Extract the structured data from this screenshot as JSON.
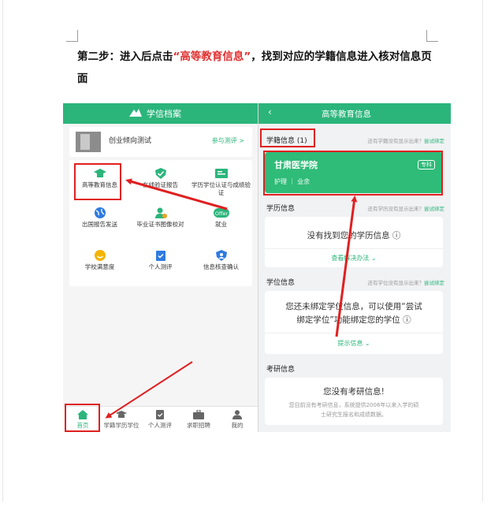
{
  "doc": {
    "intro": "第二步：进入后点击",
    "quoted": "“高等教育信息”",
    "rest": "，找到对应的学籍信息进入核对信息页面"
  },
  "left_app": {
    "title": "学信档案",
    "test_card": {
      "name": "创业倾向测试",
      "action": "参与测评 >"
    },
    "grid": [
      {
        "label": "高等教育信息",
        "icon": "graduation-cap-icon"
      },
      {
        "label": "在线验证报告",
        "icon": "shield-check-icon"
      },
      {
        "label": "学历学位认证与成绩验证",
        "icon": "certificate-icon"
      },
      {
        "label": "出国报告发送",
        "icon": "globe-icon"
      },
      {
        "label": "毕业证书图像校对",
        "icon": "person-check-icon"
      },
      {
        "label": "就业",
        "icon": "offer-icon",
        "icon_text": "Offer"
      },
      {
        "label": "学校满意度",
        "icon": "smile-icon"
      },
      {
        "label": "个人测评",
        "icon": "clipboard-check-icon"
      },
      {
        "label": "信息核查确认",
        "icon": "user-shield-icon"
      }
    ],
    "tabs": [
      {
        "label": "首页",
        "icon": "home-icon",
        "active": true
      },
      {
        "label": "学籍学历学位",
        "icon": "cap-icon",
        "active": false
      },
      {
        "label": "个人测评",
        "icon": "clipboard-icon",
        "active": false
      },
      {
        "label": "求职招聘",
        "icon": "briefcase-icon",
        "active": false
      },
      {
        "label": "我的",
        "icon": "user-icon",
        "active": false
      }
    ]
  },
  "right_app": {
    "back": "‹",
    "title": "高等教育信息",
    "xueji": {
      "title": "学籍信息 (1)",
      "hint": "还有学籍没有显示出来？",
      "hint_link": "尝试绑定",
      "school": "甘肃医学院",
      "major": "护理 ｜ 业余",
      "badge": "专科"
    },
    "xueli": {
      "title": "学历信息",
      "hint": "还有学历没有显示出来？",
      "hint_link": "尝试绑定",
      "main": "没有找到您的学历信息 ⓘ",
      "link": "查看解决办法 ⌄"
    },
    "xuewei": {
      "title": "学位信息",
      "hint": "还有学位没有显示出来？",
      "hint_link": "尝试绑定",
      "main_line1": "您还未绑定学位信息，可以使用“尝试",
      "main_line2": "绑定学位”功能绑定您的学位 ⓘ",
      "link": "提示信息 ⌄"
    },
    "kaoyan": {
      "title": "考研信息",
      "main": "您没有考研信息!",
      "small_line1": "您目前没有考研信息，系统提供2006年以来入学的硕",
      "small_line2": "士研究生报名和成绩数据。"
    }
  },
  "colors": {
    "green": "#2bb57b",
    "highlight_red": "#e02020",
    "quote_red": "#e03131"
  }
}
